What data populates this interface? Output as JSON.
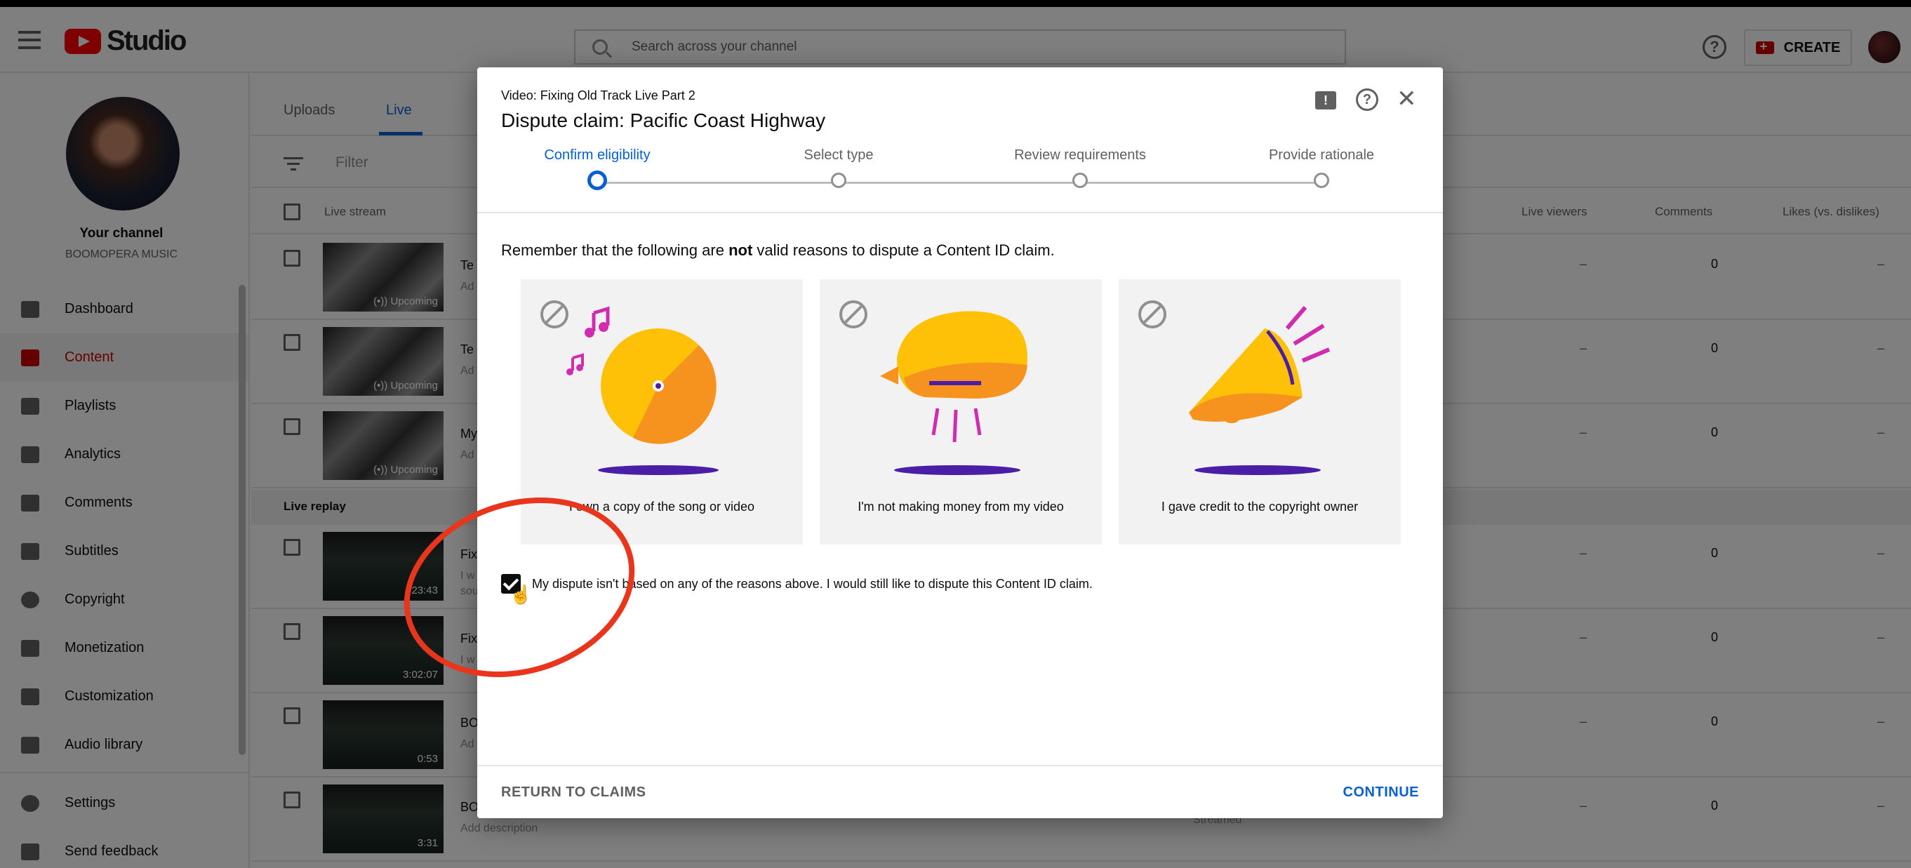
{
  "app": {
    "name": "Studio"
  },
  "search": {
    "placeholder": "Search across your channel"
  },
  "header": {
    "create_label": "CREATE",
    "help": "?"
  },
  "channel": {
    "title": "Your channel",
    "name": "BOOMOPERA MUSIC"
  },
  "sidebar": {
    "items": [
      {
        "label": "Dashboard",
        "icon": "dashboard-icon"
      },
      {
        "label": "Content",
        "icon": "content-icon",
        "active": true
      },
      {
        "label": "Playlists",
        "icon": "playlists-icon"
      },
      {
        "label": "Analytics",
        "icon": "analytics-icon"
      },
      {
        "label": "Comments",
        "icon": "comments-icon"
      },
      {
        "label": "Subtitles",
        "icon": "subtitles-icon"
      },
      {
        "label": "Copyright",
        "icon": "copyright-icon"
      },
      {
        "label": "Monetization",
        "icon": "monetization-icon"
      },
      {
        "label": "Customization",
        "icon": "customization-icon"
      },
      {
        "label": "Audio library",
        "icon": "audio-library-icon"
      }
    ],
    "bottom": [
      {
        "label": "Settings",
        "icon": "settings-icon"
      },
      {
        "label": "Send feedback",
        "icon": "feedback-icon"
      }
    ]
  },
  "content": {
    "tabs": [
      "Uploads",
      "Live"
    ],
    "filter_placeholder": "Filter",
    "columns": {
      "live_stream": "Live stream",
      "live_viewers": "Live viewers",
      "comments": "Comments",
      "likes": "Likes (vs. dislikes)"
    },
    "upcoming_rows": [
      {
        "title": "Te",
        "desc": "Ad",
        "badge": "(•)) Upcoming",
        "viewers": "–",
        "comments": "0",
        "likes": "–"
      },
      {
        "title": "Te",
        "desc": "Ad",
        "badge": "(•)) Upcoming",
        "viewers": "–",
        "comments": "0",
        "likes": "–"
      },
      {
        "title": "My",
        "desc": "Ad",
        "badge": "(•)) Upcoming",
        "viewers": "–",
        "comments": "0",
        "likes": "–"
      }
    ],
    "replay_label": "Live replay",
    "replay_rows": [
      {
        "title": "Fix",
        "desc": "I w",
        "desc2": "sou",
        "duration": "23:43",
        "viewers": "–",
        "comments": "0",
        "likes": "–"
      },
      {
        "title": "Fix",
        "desc": "I w",
        "duration": "3:02:07",
        "viewers": "–",
        "comments": "0",
        "likes": "–"
      },
      {
        "title": "BO",
        "desc": "Ad",
        "duration": "0:53",
        "viewers": "–",
        "comments": "0",
        "likes": "–"
      },
      {
        "title": "BO",
        "desc": "Add description",
        "duration": "3:31",
        "viewers": "–",
        "comments": "0",
        "likes": "–",
        "status": "Streamed"
      }
    ]
  },
  "dialog": {
    "subtitle": "Video: Fixing Old Track Live Part 2",
    "title": "Dispute claim: Pacific Coast Highway",
    "steps": [
      "Confirm eligibility",
      "Select type",
      "Review requirements",
      "Provide rationale"
    ],
    "active_step": 0,
    "note_prefix": "Remember that the following are ",
    "note_bold": "not",
    "note_suffix": " valid reasons to dispute a Content ID claim.",
    "cards": [
      {
        "label": "I own a copy of the song or video",
        "icon": "vinyl-record-icon"
      },
      {
        "label": "I'm not making money from my video",
        "icon": "piggy-bank-icon"
      },
      {
        "label": "I gave credit to the copyright owner",
        "icon": "megaphone-icon"
      }
    ],
    "checkbox_label": "My dispute isn't based on any of the reasons above. I would still like to dispute this Content ID claim.",
    "checkbox_checked": true,
    "return_label": "RETURN TO CLAIMS",
    "continue_label": "CONTINUE"
  },
  "colors": {
    "accent": "#065fd4",
    "brand": "#ff0000",
    "annotation": "#e8351c"
  }
}
